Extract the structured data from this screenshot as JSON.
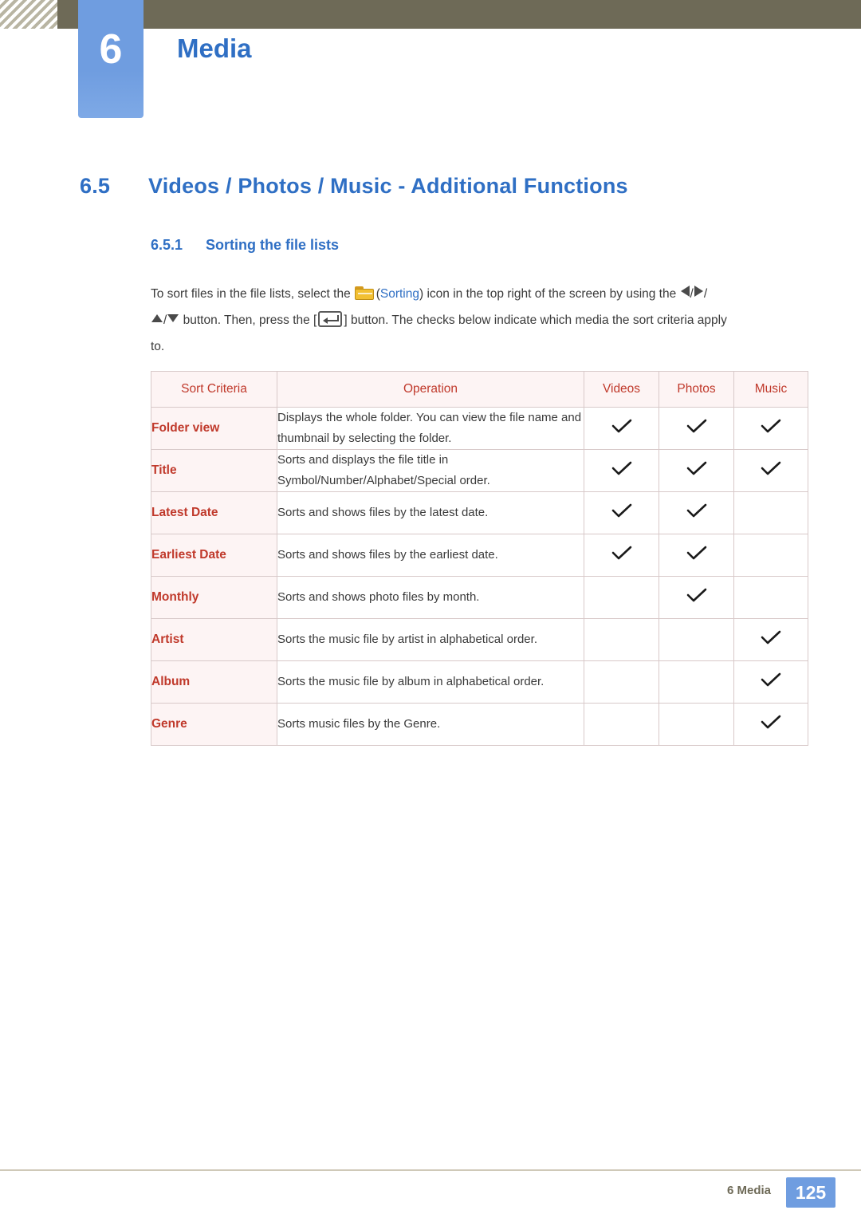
{
  "header": {
    "chapter_number": "6",
    "chapter_title": "Media"
  },
  "section": {
    "number": "6.5",
    "title": "Videos / Photos / Music - Additional Functions"
  },
  "subsection": {
    "number": "6.5.1",
    "title": "Sorting the file lists"
  },
  "body": {
    "line1_a": "To sort files in the file lists, select the",
    "line1_sorting_open": "(",
    "line1_sorting": "Sorting",
    "line1_b": ") icon in the top right of the screen by using the",
    "line1_slash1": "/",
    "line1_slash2": "/",
    "line2_a": "button. Then, press the [",
    "line2_b": "] button. The checks below indicate which media the sort criteria apply",
    "line3": "to."
  },
  "table": {
    "headers": [
      "Sort Criteria",
      "Operation",
      "Videos",
      "Photos",
      "Music"
    ],
    "rows": [
      {
        "criteria": "Folder view",
        "operation": "Displays the whole folder. You can view the file name and thumbnail by selecting the folder.",
        "videos": true,
        "photos": true,
        "music": true
      },
      {
        "criteria": "Title",
        "operation": "Sorts and displays the file title in Symbol/Number/Alphabet/Special order.",
        "videos": true,
        "photos": true,
        "music": true
      },
      {
        "criteria": "Latest Date",
        "operation": "Sorts and shows files by the latest date.",
        "videos": true,
        "photos": true,
        "music": false
      },
      {
        "criteria": "Earliest Date",
        "operation": "Sorts and shows files by the earliest date.",
        "videos": true,
        "photos": true,
        "music": false
      },
      {
        "criteria": "Monthly",
        "operation": "Sorts and shows photo files by month.",
        "videos": false,
        "photos": true,
        "music": false
      },
      {
        "criteria": "Artist",
        "operation": "Sorts the music file by artist in alphabetical order.",
        "videos": false,
        "photos": false,
        "music": true
      },
      {
        "criteria": "Album",
        "operation": "Sorts the music file by album in alphabetical order.",
        "videos": false,
        "photos": false,
        "music": true
      },
      {
        "criteria": "Genre",
        "operation": "Sorts music files by the Genre.",
        "videos": false,
        "photos": false,
        "music": true
      }
    ]
  },
  "footer": {
    "label": "6 Media",
    "page": "125"
  },
  "colors": {
    "accent_blue": "#2f6fc4",
    "tab_blue": "#6f9de0",
    "band_olive": "#6e6a57",
    "table_red": "#c0392b",
    "table_tint": "#fdf4f4"
  },
  "icons": {
    "sorting": "folder-icon",
    "enter": "enter-key-icon",
    "left": "arrow-left-icon",
    "right": "arrow-right-icon",
    "up": "arrow-up-icon",
    "down": "arrow-down-icon",
    "check": "checkmark-icon"
  }
}
